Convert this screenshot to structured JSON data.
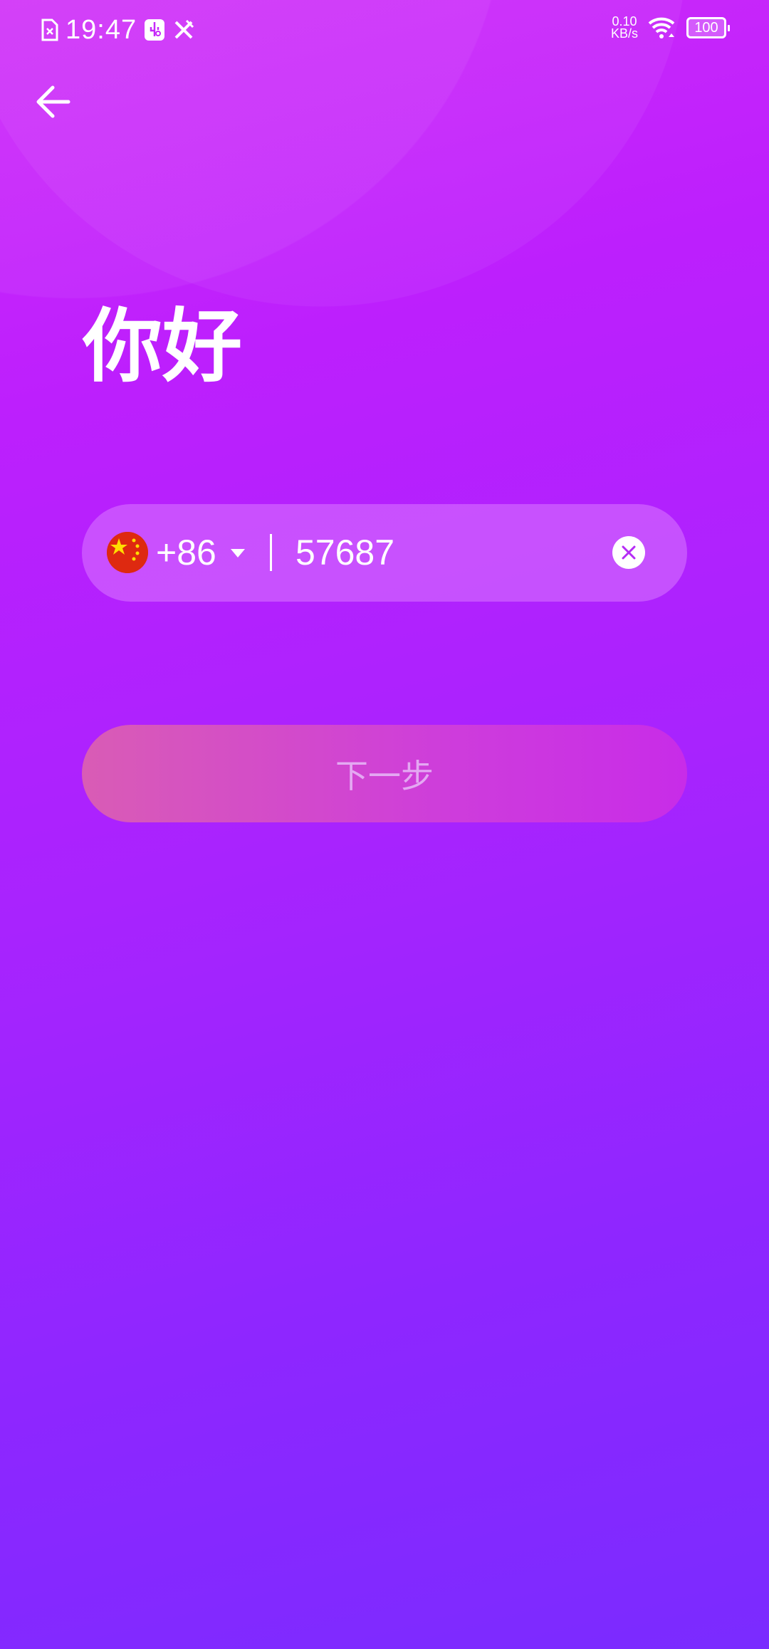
{
  "status_bar": {
    "time": "19:47",
    "net_speed_value": "0.10",
    "net_speed_unit": "KB/s",
    "battery": "100",
    "icons": [
      "sim-missing-icon",
      "usb-debug-icon",
      "tools-icon",
      "wifi-icon",
      "battery-icon"
    ]
  },
  "header": {
    "back_icon": "arrow-left-icon"
  },
  "title": "你好",
  "phone_input": {
    "country_code": "+86",
    "country_flag": "china-flag-icon",
    "value": "57687",
    "clear_icon": "clear-circle-icon"
  },
  "next_button": {
    "label": "下一步"
  },
  "colors": {
    "bg_top": "#d02cf8",
    "bg_bottom": "#7a2bff",
    "flag_red": "#de2910",
    "flag_star": "#ffde00"
  }
}
